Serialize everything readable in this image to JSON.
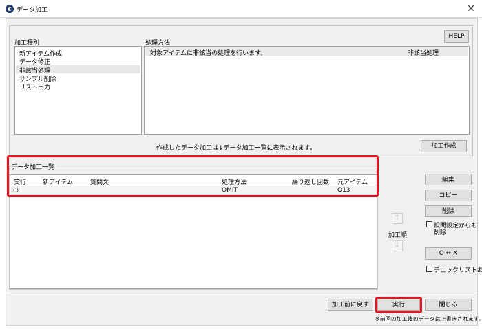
{
  "window": {
    "title": "データ加工",
    "close_glyph": "✕"
  },
  "top_panel": {
    "help_label": "HELP",
    "types_label": "加工種別",
    "types": [
      "新アイテム作成",
      "データ修正",
      "非該当処理",
      "サンプル削除",
      "リスト出力"
    ],
    "selected_type_index": 2,
    "method_label": "処理方法",
    "method_text": "対象アイテムに非該当の処理を行います。",
    "method_tag": "非該当処理",
    "info_text": "作成したデータ加工は↓データ加工一覧に表示されます。",
    "create_label": "加工作成"
  },
  "list_panel": {
    "title": "データ加工一覧",
    "columns": [
      "実行",
      "新アイテム",
      "質問文",
      "処理方法",
      "繰り返し回数",
      "元アイテム"
    ],
    "rows": [
      {
        "run": "○",
        "new_item": "",
        "question": "",
        "method": "OMIT",
        "repeat": "",
        "source": "Q13"
      }
    ]
  },
  "side": {
    "edit_label": "編集",
    "copy_label": "コピー",
    "delete_label": "削除",
    "delete_setting_label_1": "設問設定からも",
    "delete_setting_label_2": "削除",
    "order_label": "加工順",
    "up_glyph": "↑",
    "down_glyph": "↓",
    "ox_label": "O ⇔ X",
    "checklist_label": "チェックリストあり"
  },
  "footer": {
    "revert_label": "加工前に戻す",
    "execute_label": "実行",
    "close_label": "閉じる",
    "note": "※前回の加工後のデータは上書きされます。"
  },
  "colors": {
    "highlight": "#e8141f",
    "window_bg": "#f0f0f0"
  }
}
